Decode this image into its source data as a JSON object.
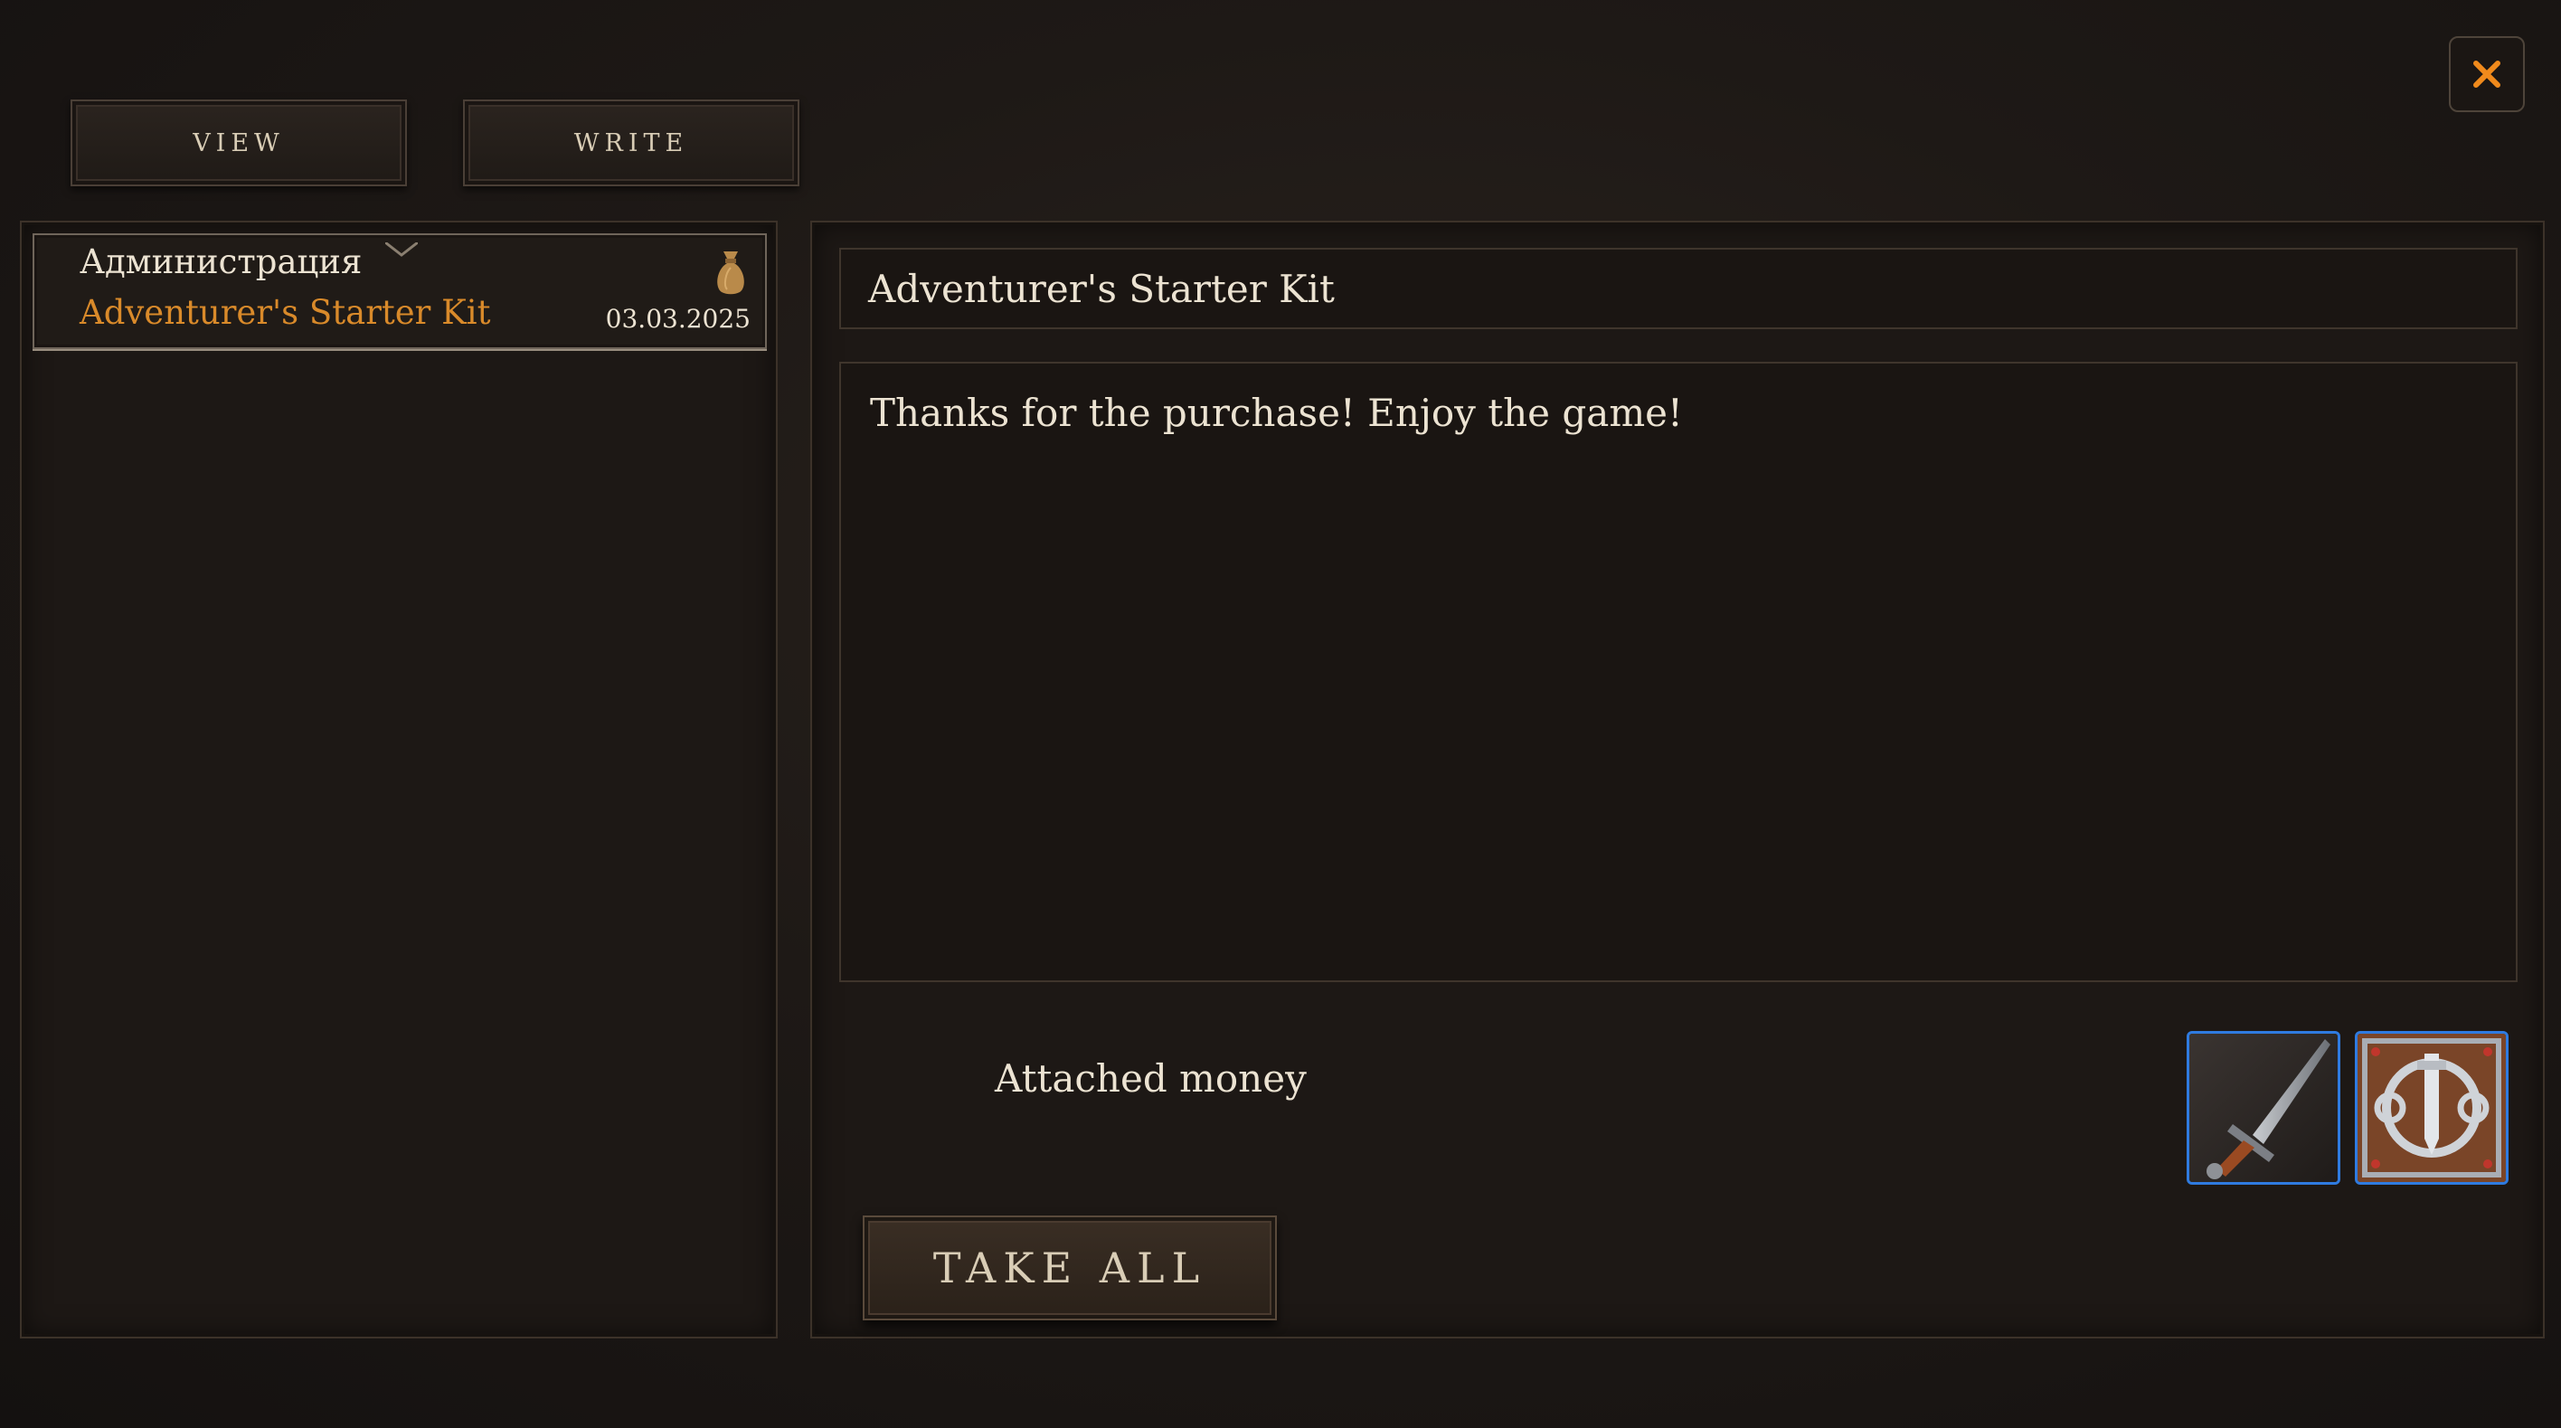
{
  "tabs": {
    "view_label": "VIEW",
    "write_label": "WRITE"
  },
  "mail_list": {
    "items": [
      {
        "sender": "Администрация",
        "subject": "Adventurer's Starter Kit",
        "date": "03.03.2025",
        "icon": "money-bag-icon"
      }
    ]
  },
  "mail_detail": {
    "subject": "Adventurer's Starter Kit",
    "body": "Thanks for the purchase! Enjoy the game!",
    "attached_label": "Attached money",
    "attachments": [
      {
        "icon": "sword-icon"
      },
      {
        "icon": "shield-emblem-icon"
      }
    ],
    "take_all_label": "TAKE ALL"
  },
  "colors": {
    "accent": "#d98a2a",
    "close": "#f08a1c",
    "slot_border": "#2f7be0",
    "text": "#ece3d2"
  }
}
